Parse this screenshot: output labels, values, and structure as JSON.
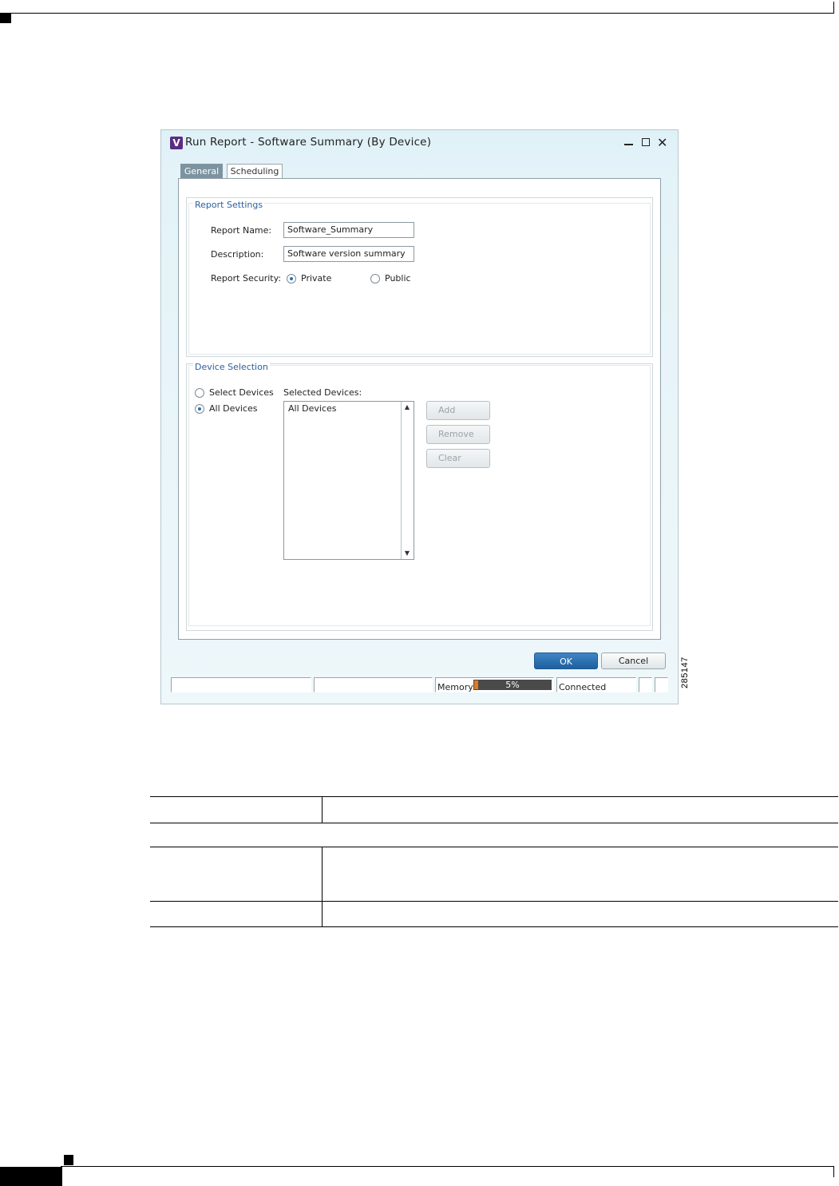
{
  "window": {
    "icon_letter": "V",
    "title": "Run Report - Software Summary (By Device)"
  },
  "tabs": [
    {
      "label": "General",
      "active": true
    },
    {
      "label": "Scheduling",
      "active": false
    }
  ],
  "report_settings": {
    "legend": "Report Settings",
    "name_label": "Report Name:",
    "name_value": "Software_Summary",
    "description_label": "Description:",
    "description_value": "Software version summary",
    "security_label": "Report Security:",
    "security_options": [
      {
        "label": "Private",
        "selected": true
      },
      {
        "label": "Public",
        "selected": false
      }
    ]
  },
  "device_selection": {
    "legend": "Device Selection",
    "options": [
      {
        "label": "Select Devices",
        "selected": false
      },
      {
        "label": "All Devices",
        "selected": true
      }
    ],
    "selected_label": "Selected Devices:",
    "selected_items": [
      "All Devices"
    ],
    "buttons": {
      "add": "Add",
      "remove": "Remove",
      "clear": "Clear"
    }
  },
  "dialog_buttons": {
    "ok": "OK",
    "cancel": "Cancel"
  },
  "status_bar": {
    "memory_label": "Memory:",
    "memory_percent": "5%",
    "memory_fraction": 0.05,
    "connection": "Connected"
  },
  "figure_number": "285147",
  "colors": {
    "accent": "#2b5f9e",
    "ok_button": "#2a6fb0",
    "tab_active": "#7d94a0",
    "memory_fill": "#e07a20"
  }
}
